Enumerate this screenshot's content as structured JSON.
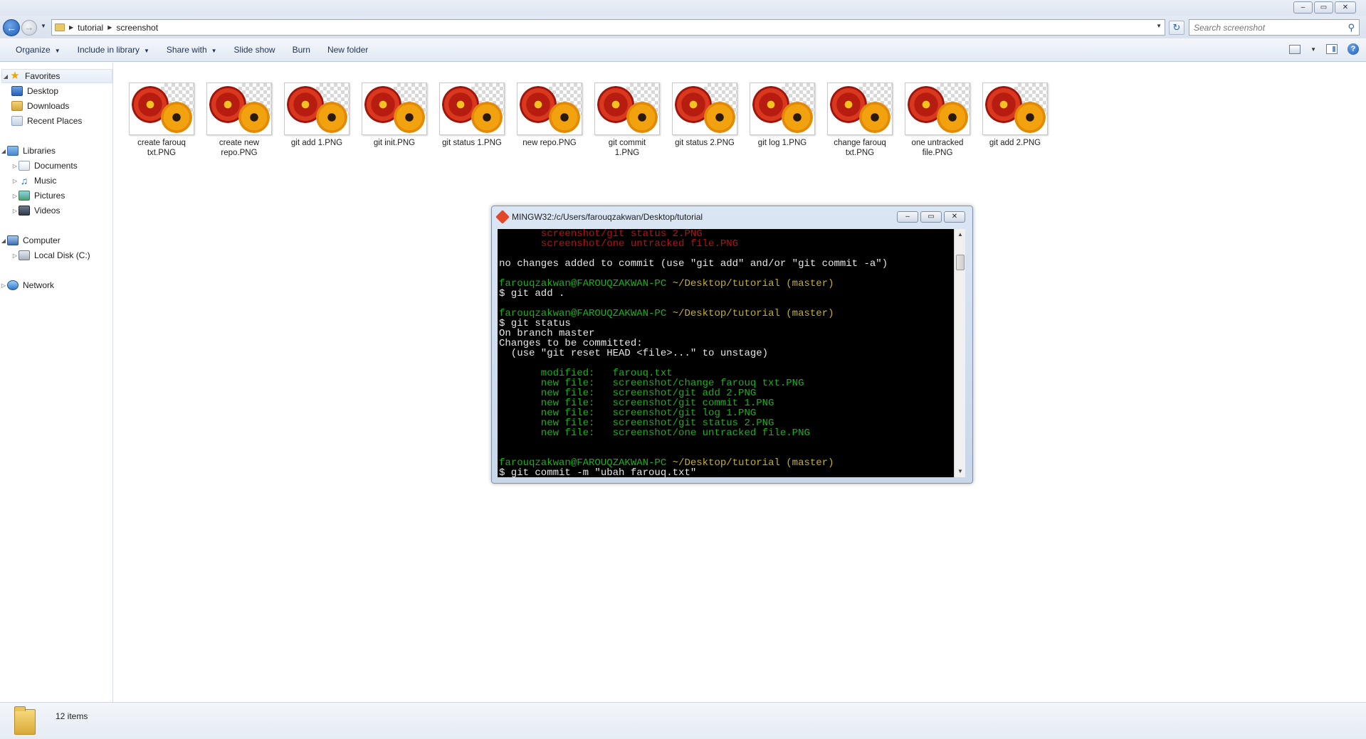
{
  "window": {
    "controls": [
      "–",
      "▭",
      "✕"
    ]
  },
  "address": {
    "crumbs": [
      "tutorial",
      "screenshot"
    ]
  },
  "search": {
    "placeholder": "Search screenshot"
  },
  "toolbar": {
    "organize": "Organize",
    "include_in_library": "Include in library",
    "share_with": "Share with",
    "slide_show": "Slide show",
    "burn": "Burn",
    "new_folder": "New folder"
  },
  "nav": {
    "favorites": "Favorites",
    "desktop": "Desktop",
    "downloads": "Downloads",
    "recent_places": "Recent Places",
    "libraries": "Libraries",
    "documents": "Documents",
    "music": "Music",
    "pictures": "Pictures",
    "videos": "Videos",
    "computer": "Computer",
    "local_disk": "Local Disk (C:)",
    "network": "Network"
  },
  "files": [
    {
      "line1": "create farouq",
      "line2": "txt.PNG"
    },
    {
      "line1": "create new",
      "line2": "repo.PNG"
    },
    {
      "line1": "git add 1.PNG",
      "line2": ""
    },
    {
      "line1": "git init.PNG",
      "line2": ""
    },
    {
      "line1": "git status 1.PNG",
      "line2": ""
    },
    {
      "line1": "new repo.PNG",
      "line2": ""
    },
    {
      "line1": "git commit",
      "line2": "1.PNG"
    },
    {
      "line1": "git status 2.PNG",
      "line2": ""
    },
    {
      "line1": "git log 1.PNG",
      "line2": ""
    },
    {
      "line1": "change farouq",
      "line2": "txt.PNG"
    },
    {
      "line1": "one untracked",
      "line2": "file.PNG"
    },
    {
      "line1": "git add 2.PNG",
      "line2": ""
    }
  ],
  "terminal": {
    "title": "MINGW32:/c/Users/farouqzakwan/Desktop/tutorial",
    "lines": [
      {
        "parts": [
          {
            "text": "       screenshot/git status 2.PNG",
            "color": "red"
          }
        ]
      },
      {
        "parts": [
          {
            "text": "       screenshot/one untracked file.PNG",
            "color": "red"
          }
        ]
      },
      {
        "parts": [
          {
            "text": "",
            "color": "white"
          }
        ]
      },
      {
        "parts": [
          {
            "text": "no changes added to commit (use \"git add\" and/or \"git commit -a\")",
            "color": "white"
          }
        ]
      },
      {
        "parts": [
          {
            "text": "",
            "color": "white"
          }
        ]
      },
      {
        "parts": [
          {
            "text": "farouqzakwan@FAROUQZAKWAN-PC ",
            "color": "green"
          },
          {
            "text": "~/Desktop/tutorial (master)",
            "color": "yellow"
          }
        ]
      },
      {
        "parts": [
          {
            "text": "$ git add .",
            "color": "white"
          }
        ]
      },
      {
        "parts": [
          {
            "text": "",
            "color": "white"
          }
        ]
      },
      {
        "parts": [
          {
            "text": "farouqzakwan@FAROUQZAKWAN-PC ",
            "color": "green"
          },
          {
            "text": "~/Desktop/tutorial (master)",
            "color": "yellow"
          }
        ]
      },
      {
        "parts": [
          {
            "text": "$ git status",
            "color": "white"
          }
        ]
      },
      {
        "parts": [
          {
            "text": "On branch master",
            "color": "white"
          }
        ]
      },
      {
        "parts": [
          {
            "text": "Changes to be committed:",
            "color": "white"
          }
        ]
      },
      {
        "parts": [
          {
            "text": "  (use \"git reset HEAD <file>...\" to unstage)",
            "color": "white"
          }
        ]
      },
      {
        "parts": [
          {
            "text": "",
            "color": "white"
          }
        ]
      },
      {
        "parts": [
          {
            "text": "       modified:   farouq.txt",
            "color": "green"
          }
        ]
      },
      {
        "parts": [
          {
            "text": "       new file:   screenshot/change farouq txt.PNG",
            "color": "green"
          }
        ]
      },
      {
        "parts": [
          {
            "text": "       new file:   screenshot/git add 2.PNG",
            "color": "green"
          }
        ]
      },
      {
        "parts": [
          {
            "text": "       new file:   screenshot/git commit 1.PNG",
            "color": "green"
          }
        ]
      },
      {
        "parts": [
          {
            "text": "       new file:   screenshot/git log 1.PNG",
            "color": "green"
          }
        ]
      },
      {
        "parts": [
          {
            "text": "       new file:   screenshot/git status 2.PNG",
            "color": "green"
          }
        ]
      },
      {
        "parts": [
          {
            "text": "       new file:   screenshot/one untracked file.PNG",
            "color": "green"
          }
        ]
      },
      {
        "parts": [
          {
            "text": "",
            "color": "white"
          }
        ]
      },
      {
        "parts": [
          {
            "text": "",
            "color": "white"
          }
        ]
      },
      {
        "parts": [
          {
            "text": "farouqzakwan@FAROUQZAKWAN-PC ",
            "color": "green"
          },
          {
            "text": "~/Desktop/tutorial (master)",
            "color": "yellow"
          }
        ]
      },
      {
        "parts": [
          {
            "text": "$ git commit -m \"ubah farouq.txt\"",
            "color": "white"
          }
        ]
      }
    ]
  },
  "status": {
    "item_count": "12 items"
  },
  "colors": {
    "terminal_green": "#15b315",
    "terminal_red": "#b4130f",
    "terminal_yellow": "#c6b021",
    "terminal_bg": "#000000"
  },
  "icons": {
    "nav_back": "back-arrow-icon",
    "nav_forward": "forward-arrow-icon",
    "refresh": "refresh-icon",
    "search": "magnifier-icon",
    "help": "help-icon"
  }
}
